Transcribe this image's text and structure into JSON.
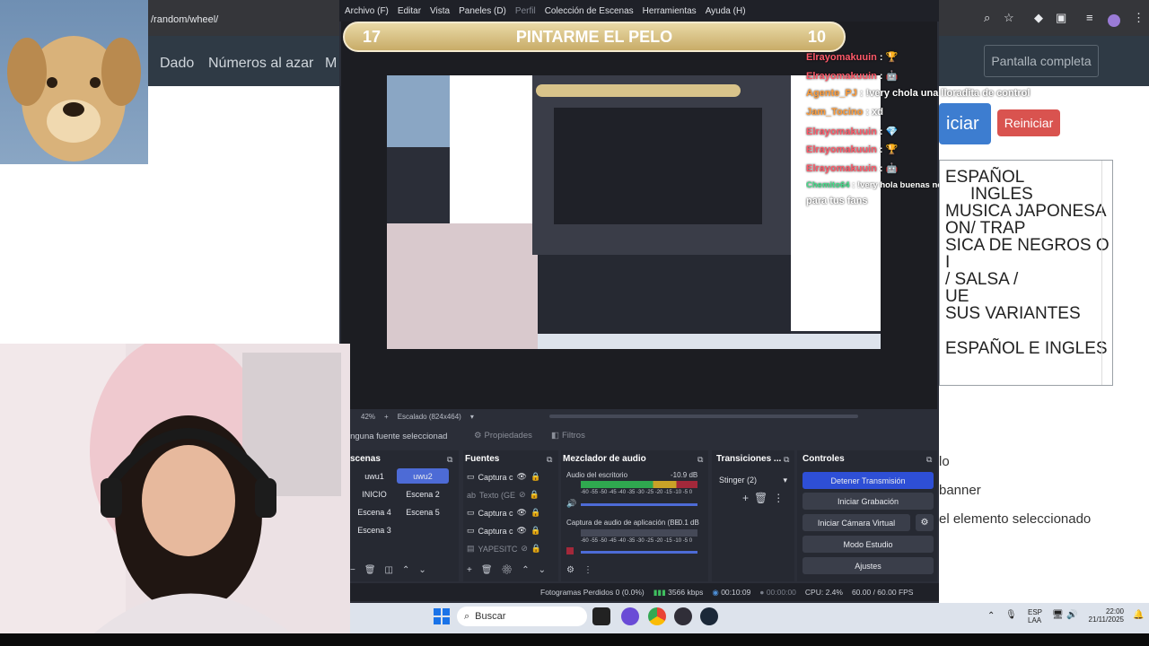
{
  "browser": {
    "url": "/random/wheel/",
    "nav_dado": "Dado",
    "nav_numeros": "Números al azar",
    "nav_more": "M",
    "fullscreen": "Pantalla completa",
    "girar": "iciar",
    "reiniciar": "Reiniciar",
    "wheel_lines": [
      "ESPAÑOL",
      "INGLES",
      "MUSICA JAPONESA",
      "ON/ TRAP",
      "SICA DE NEGROS O",
      "I",
      "/ SALSA /",
      "UE",
      "SUS VARIANTES",
      "",
      "ESPAÑOL E INGLES"
    ],
    "options": [
      "lo",
      "banner",
      "el elemento seleccionado"
    ]
  },
  "obs": {
    "menu": [
      "Archivo (F)",
      "Editar",
      "Vista",
      "Paneles (D)",
      "Perfil",
      "Colección de Escenas",
      "Herramientas",
      "Ayuda (H)"
    ],
    "banner_left": "17",
    "banner_title": "PINTARME EL PELO",
    "banner_right": "10",
    "zoom": "42%",
    "scaling": "Escalado (824x464)",
    "no_source": "inguna fuente seleccionad",
    "properties": "Propiedades",
    "filters": "Filtros",
    "scenes_title": "scenas",
    "scenes": [
      "uwu1",
      "uwu2",
      "INICIO",
      "Escena 2",
      "Escena 4",
      "Escena 5",
      "Escena 3"
    ],
    "sources_title": "Fuentes",
    "sources": [
      "Captura c",
      "Texto (GE",
      "Captura c",
      "Captura c",
      "YAPESITC"
    ],
    "mixer_title": "Mezclador de audio",
    "mixer_ch1": "Audio del escritorio",
    "mixer_ch1_db": "-10.9 dB",
    "mixer_ch2": "Captura de audio de aplicación (BE",
    "mixer_ch2_db": "-0.1 dB",
    "mixer_scale": "-60 -55 -50 -45 -40 -35 -30 -25 -20 -15 -10 -5 0",
    "transitions_title": "Transiciones ...",
    "transition_value": "Stinger (2)",
    "controls_title": "Controles",
    "controls": [
      "Detener Transmisión",
      "Iniciar Grabación",
      "Iniciar Cámara Virtual",
      "Modo Estudio",
      "Ajustes"
    ],
    "status_dropped": "Fotogramas Perdidos 0 (0.0%)",
    "status_bitrate": "3566 kbps",
    "status_stream_time": "00:10:09",
    "status_rec_time": "00:00:00",
    "status_cpu": "CPU: 2.4%",
    "status_fps": "60.00 / 60.00 FPS"
  },
  "chat": [
    {
      "name": "Elrayomakuuin",
      "msg": ": 🏆",
      "color": "red"
    },
    {
      "name": "Elrayomakuuin",
      "msg": ": 🤖",
      "color": "red"
    },
    {
      "name": "Agente_PJ",
      "msg": ": !very chola una lloradita de control",
      "color": "orange"
    },
    {
      "name": "Jam_Tocino",
      "msg": ": xd",
      "color": "orange"
    },
    {
      "name": "Elrayomakuuin",
      "msg": ": 💎",
      "color": "red"
    },
    {
      "name": "Elrayomakuuin",
      "msg": ": 🏆",
      "color": "red"
    },
    {
      "name": "Elrayomakuuin",
      "msg": ": 🤖",
      "color": "red"
    },
    {
      "name": "Chemito64",
      "msg": ": !very hola buenas noches preciosa Nicolsita, una vueltita",
      "color": "green"
    },
    {
      "name": "",
      "msg": "para tus fans",
      "color": "none"
    }
  ],
  "taskbar": {
    "search": "Buscar",
    "lang1": "ESP",
    "lang2": "LAA",
    "time": "22:00",
    "date": "21/11/2025"
  }
}
